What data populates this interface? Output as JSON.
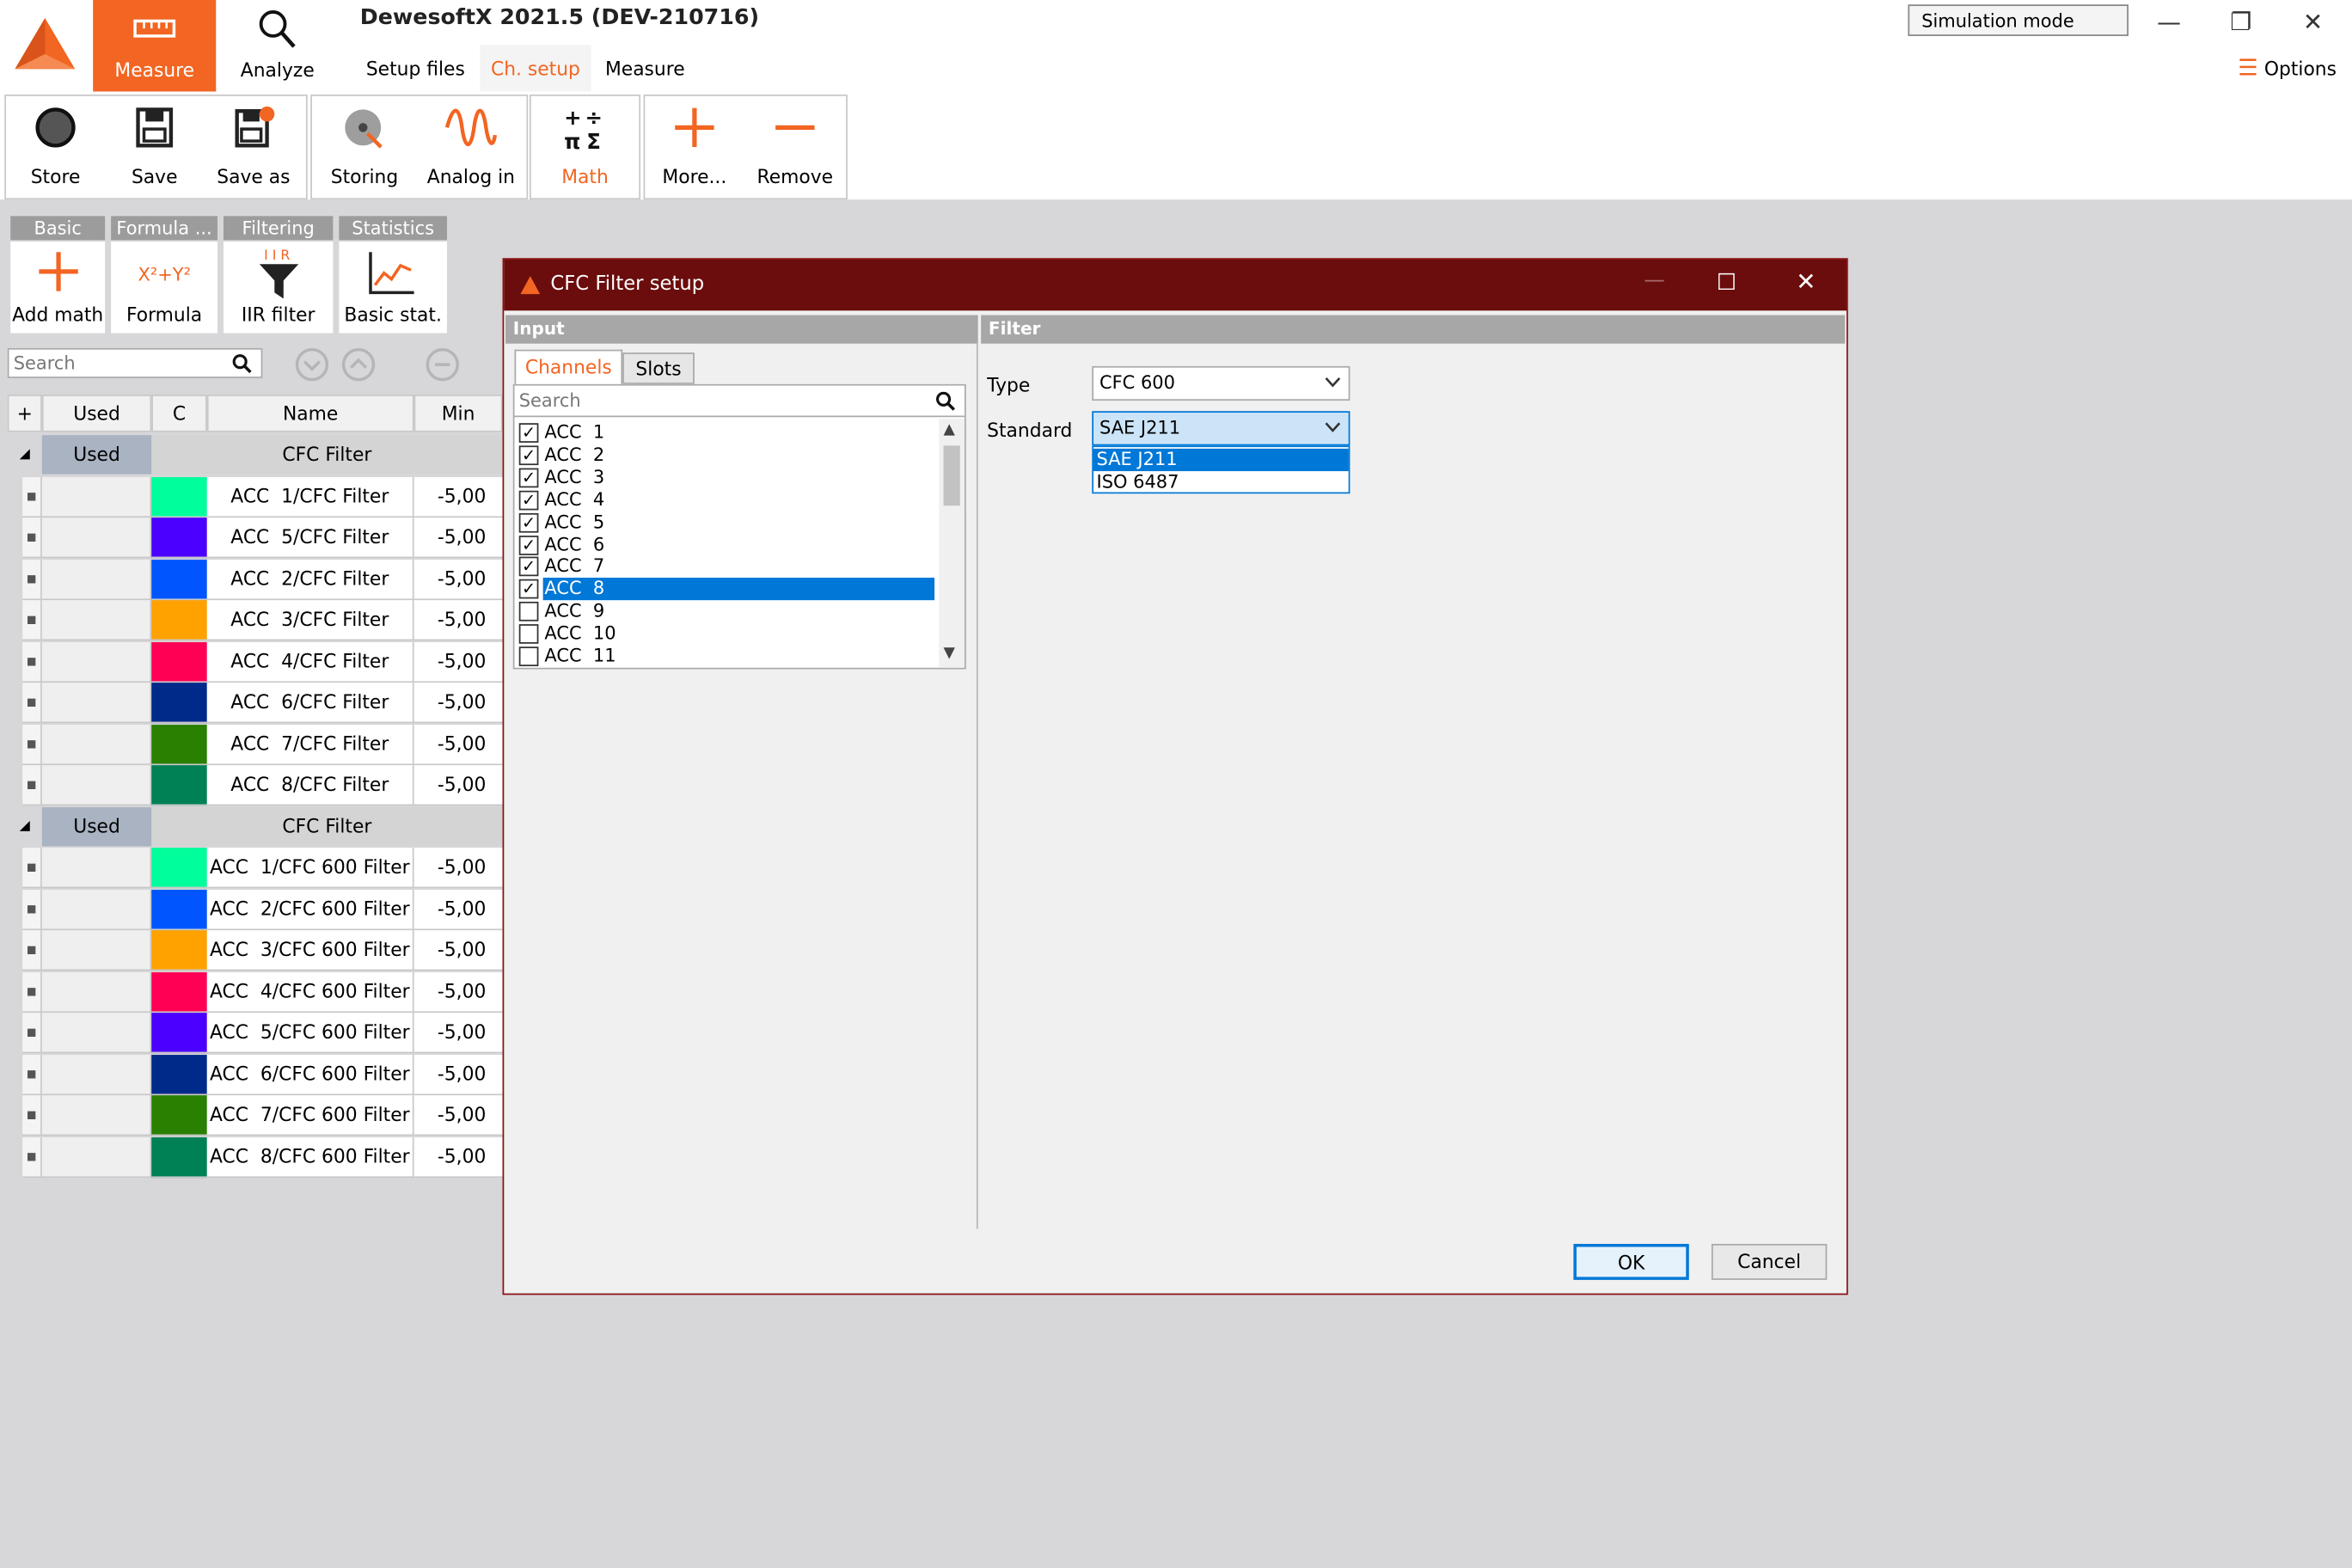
{
  "app": {
    "title": "DewesoftX 2021.5 (DEV-210716)",
    "modes": [
      "Measure",
      "Analyze"
    ],
    "tabs": [
      "Setup files",
      "Ch. setup",
      "Measure"
    ],
    "active_tab": "Ch. setup",
    "simulation_mode": "Simulation mode",
    "options_label": "Options",
    "accent": "#f26522"
  },
  "toolbar": {
    "store": "Store",
    "save": "Save",
    "save_as": "Save as",
    "storing": "Storing",
    "analog_in": "Analog in",
    "math": "Math",
    "more": "More...",
    "remove": "Remove"
  },
  "math_toolbar": {
    "groups": [
      "Basic",
      "Formula ...",
      "Filtering",
      "Statistics"
    ],
    "buttons": [
      "Add math",
      "Formula",
      "IIR filter",
      "Basic stat."
    ],
    "search_placeholder": "Search"
  },
  "channel_table": {
    "columns": [
      "+",
      "Used",
      "C",
      "Name",
      "Min"
    ],
    "groups": [
      {
        "used": "Used",
        "name": "CFC Filter",
        "rows": [
          {
            "color": "#00ff9c",
            "name": "ACC  1/CFC Filter",
            "min": "-5,00"
          },
          {
            "color": "#4b00ff",
            "name": "ACC  5/CFC Filter",
            "min": "-5,00"
          },
          {
            "color": "#0055ff",
            "name": "ACC  2/CFC Filter",
            "min": "-5,00"
          },
          {
            "color": "#ffa200",
            "name": "ACC  3/CFC Filter",
            "min": "-5,00"
          },
          {
            "color": "#ff0055",
            "name": "ACC  4/CFC Filter",
            "min": "-5,00"
          },
          {
            "color": "#002a8a",
            "name": "ACC  6/CFC Filter",
            "min": "-5,00"
          },
          {
            "color": "#2a8000",
            "name": "ACC  7/CFC Filter",
            "min": "-5,00"
          },
          {
            "color": "#008055",
            "name": "ACC  8/CFC Filter",
            "min": "-5,00"
          }
        ]
      },
      {
        "used": "Used",
        "name": "CFC Filter",
        "rows": [
          {
            "color": "#00ff9c",
            "name": "ACC  1/CFC 600 Filter",
            "min": "-5,00"
          },
          {
            "color": "#0055ff",
            "name": "ACC  2/CFC 600 Filter",
            "min": "-5,00"
          },
          {
            "color": "#ffa200",
            "name": "ACC  3/CFC 600 Filter",
            "min": "-5,00"
          },
          {
            "color": "#ff0055",
            "name": "ACC  4/CFC 600 Filter",
            "min": "-5,00"
          },
          {
            "color": "#4b00ff",
            "name": "ACC  5/CFC 600 Filter",
            "min": "-5,00"
          },
          {
            "color": "#002a8a",
            "name": "ACC  6/CFC 600 Filter",
            "min": "-5,00"
          },
          {
            "color": "#2a8000",
            "name": "ACC  7/CFC 600 Filter",
            "min": "-5,00"
          },
          {
            "color": "#008055",
            "name": "ACC  8/CFC 600 Filter",
            "min": "-5,00"
          }
        ]
      }
    ]
  },
  "dialog": {
    "title": "CFC Filter setup",
    "input_header": "Input",
    "filter_header": "Filter",
    "tabs": [
      "Channels",
      "Slots"
    ],
    "search_placeholder": "Search",
    "channels": [
      {
        "name": "ACC  1",
        "checked": true,
        "selected": false
      },
      {
        "name": "ACC  2",
        "checked": true,
        "selected": false
      },
      {
        "name": "ACC  3",
        "checked": true,
        "selected": false
      },
      {
        "name": "ACC  4",
        "checked": true,
        "selected": false
      },
      {
        "name": "ACC  5",
        "checked": true,
        "selected": false
      },
      {
        "name": "ACC  6",
        "checked": true,
        "selected": false
      },
      {
        "name": "ACC  7",
        "checked": true,
        "selected": false
      },
      {
        "name": "ACC  8",
        "checked": true,
        "selected": true
      },
      {
        "name": "ACC  9",
        "checked": false,
        "selected": false
      },
      {
        "name": "ACC  10",
        "checked": false,
        "selected": false
      },
      {
        "name": "ACC  11",
        "checked": false,
        "selected": false
      }
    ],
    "type_label": "Type",
    "type_value": "CFC 600",
    "standard_label": "Standard",
    "standard_value": "SAE J211",
    "standard_options": [
      "SAE J211",
      "ISO 6487"
    ],
    "ok": "OK",
    "cancel": "Cancel",
    "title_color": "#6b0d0d",
    "selection_color": "#0078d7"
  }
}
